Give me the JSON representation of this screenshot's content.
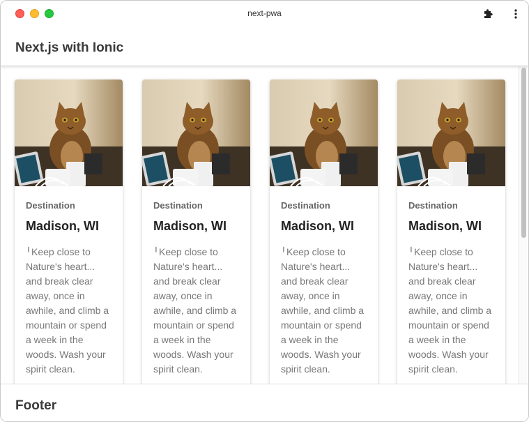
{
  "window": {
    "title": "next-pwa"
  },
  "header": {
    "title": "Next.js with Ionic"
  },
  "cards": [
    {
      "subtitle": "Destination",
      "title": "Madison, WI",
      "text": "Keep close to Nature's heart... and break clear away, once in awhile, and climb a mountain or spend a week in the woods. Wash your spirit clean."
    },
    {
      "subtitle": "Destination",
      "title": "Madison, WI",
      "text": "Keep close to Nature's heart... and break clear away, once in awhile, and climb a mountain or spend a week in the woods. Wash your spirit clean."
    },
    {
      "subtitle": "Destination",
      "title": "Madison, WI",
      "text": "Keep close to Nature's heart... and break clear away, once in awhile, and climb a mountain or spend a week in the woods. Wash your spirit clean."
    },
    {
      "subtitle": "Destination",
      "title": "Madison, WI",
      "text": "Keep close to Nature's heart... and break clear away, once in awhile, and climb a mountain or spend a week in the woods. Wash your spirit clean."
    }
  ],
  "footer": {
    "title": "Footer"
  },
  "icons": {
    "extensions": "puzzle-piece-icon",
    "menu": "kebab-menu-icon",
    "pin": "pin-icon"
  },
  "colors": {
    "close": "#ff5f57",
    "minimize": "#febc2e",
    "maximize": "#28c840"
  }
}
